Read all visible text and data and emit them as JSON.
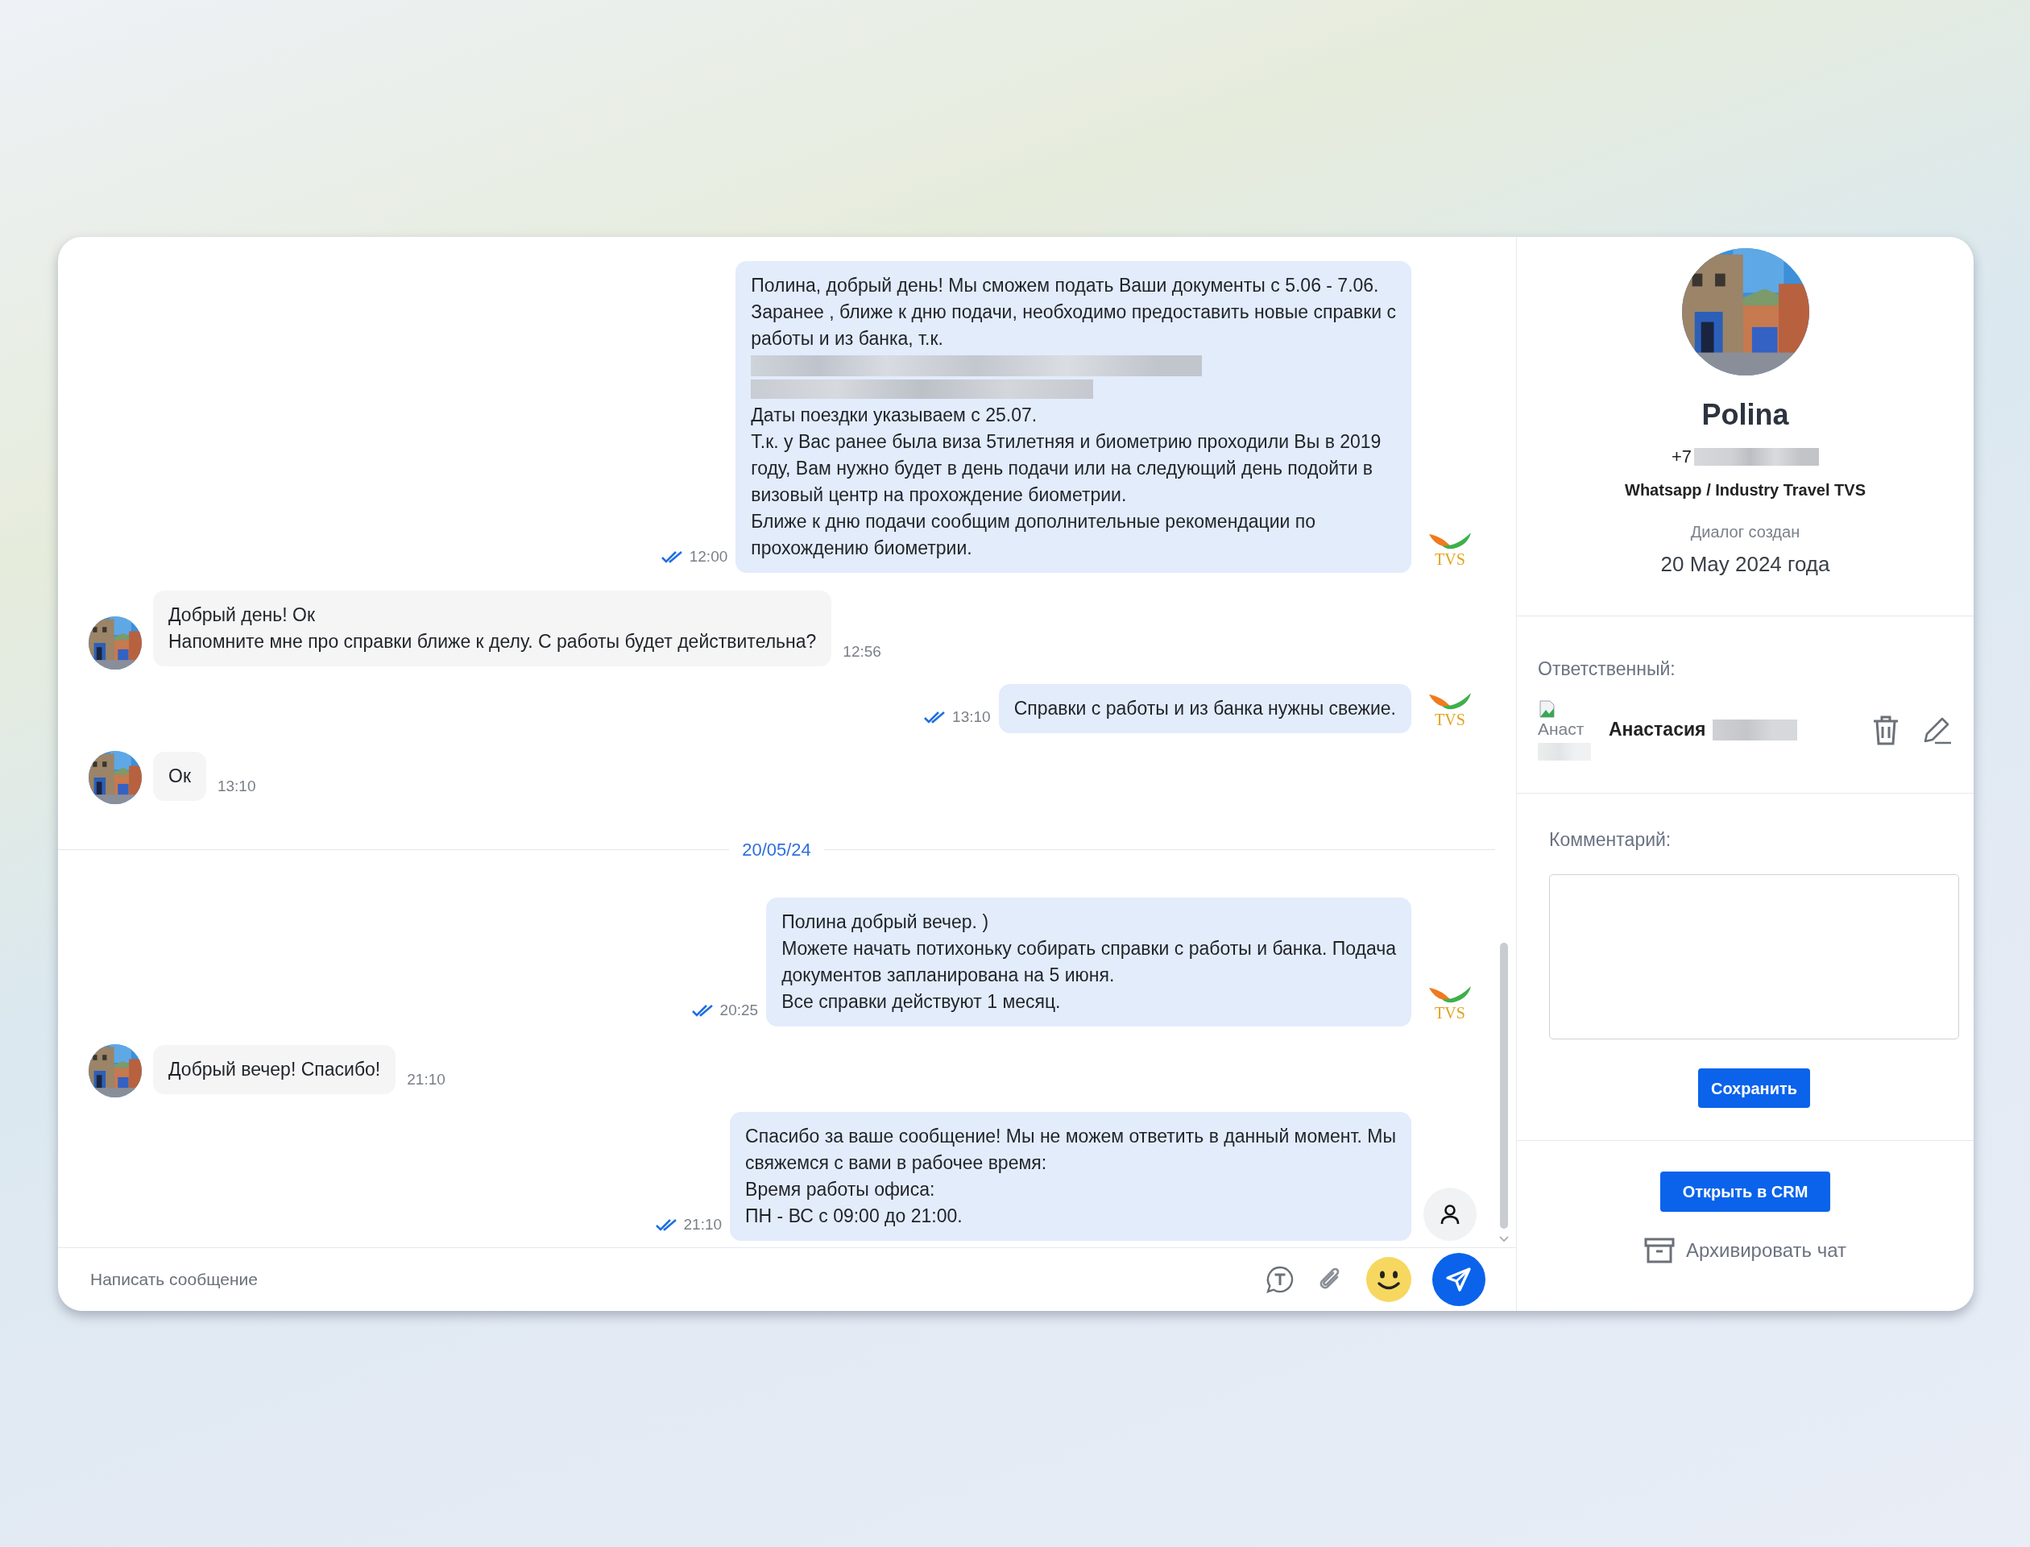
{
  "messages": [
    {
      "kind": "out",
      "segments": [
        {
          "kind": "text",
          "text": "Полина, добрый день! Мы сможем подать Ваши документы с 5.06 - 7.06.\nЗаранее , ближе к дню подачи, необходимо предоставить новые справки с\nработы и из банка, т.к."
        },
        {
          "kind": "redacted"
        },
        {
          "kind": "text",
          "text": "Даты поездки указываем с 25.07.\nТ.к. у Вас ранее была виза 5тилетняя и биометрию проходили Вы в 2019\nгоду, Вам нужно будет в день подачи или на следующий день подойти в\nвизовый центр на прохождение биометрии.\nБлиже к дню подачи сообщим дополнительные рекомендации по\nпрохождению биометрии."
        }
      ],
      "time": "12:00",
      "read": true,
      "sender": {
        "kind": "logo",
        "text": "TVS"
      }
    },
    {
      "kind": "in",
      "text": "Добрый день! Ок\nНапомните мне про справки ближе к делу. С работы будет действительна?",
      "time": "12:56"
    },
    {
      "kind": "out",
      "segments": [
        {
          "kind": "text",
          "text": "Справки с работы и из банка нужны свежие."
        }
      ],
      "time": "13:10",
      "read": true,
      "sender": {
        "kind": "logo",
        "text": "TVS"
      }
    },
    {
      "kind": "in",
      "text": "Ок",
      "time": "13:10"
    },
    {
      "kind": "date",
      "text": "20/05/24"
    },
    {
      "kind": "out",
      "segments": [
        {
          "kind": "text",
          "text": "Полина добрый вечер. )\nМожете начать потихоньку собирать справки с работы и банка. Подача\nдокументов запланирована на 5 июня.\nВсе справки действуют 1 месяц."
        }
      ],
      "time": "20:25",
      "read": true,
      "sender": {
        "kind": "logo",
        "text": "TVS"
      }
    },
    {
      "kind": "in",
      "text": "Добрый вечер! Спасибо!",
      "time": "21:10"
    },
    {
      "kind": "out",
      "segments": [
        {
          "kind": "text",
          "text": "Спасибо за ваше сообщение! Мы не можем ответить в данный момент. Мы\nсвяжемся с вами в рабочее время:\nВремя работы офиса:\nПН - ВС с 09:00 до 21:00."
        }
      ],
      "time": "21:10",
      "read": true,
      "sender": {
        "kind": "person"
      }
    }
  ],
  "composer": {
    "placeholder": "Написать сообщение"
  },
  "contact": {
    "name": "Polina",
    "phone_prefix": "+7",
    "channel": "Whatsapp / Industry Travel TVS",
    "created_label": "Диалог создан",
    "created_date": "20 May 2024 года"
  },
  "responsible": {
    "label": "Ответственный:",
    "image_alt": "Анаст",
    "name": "Анастасия"
  },
  "comment": {
    "label": "Комментарий:",
    "button": "Сохранить"
  },
  "actions": {
    "crm_button": "Открыть в CRM",
    "archive": "Архивировать чат"
  }
}
